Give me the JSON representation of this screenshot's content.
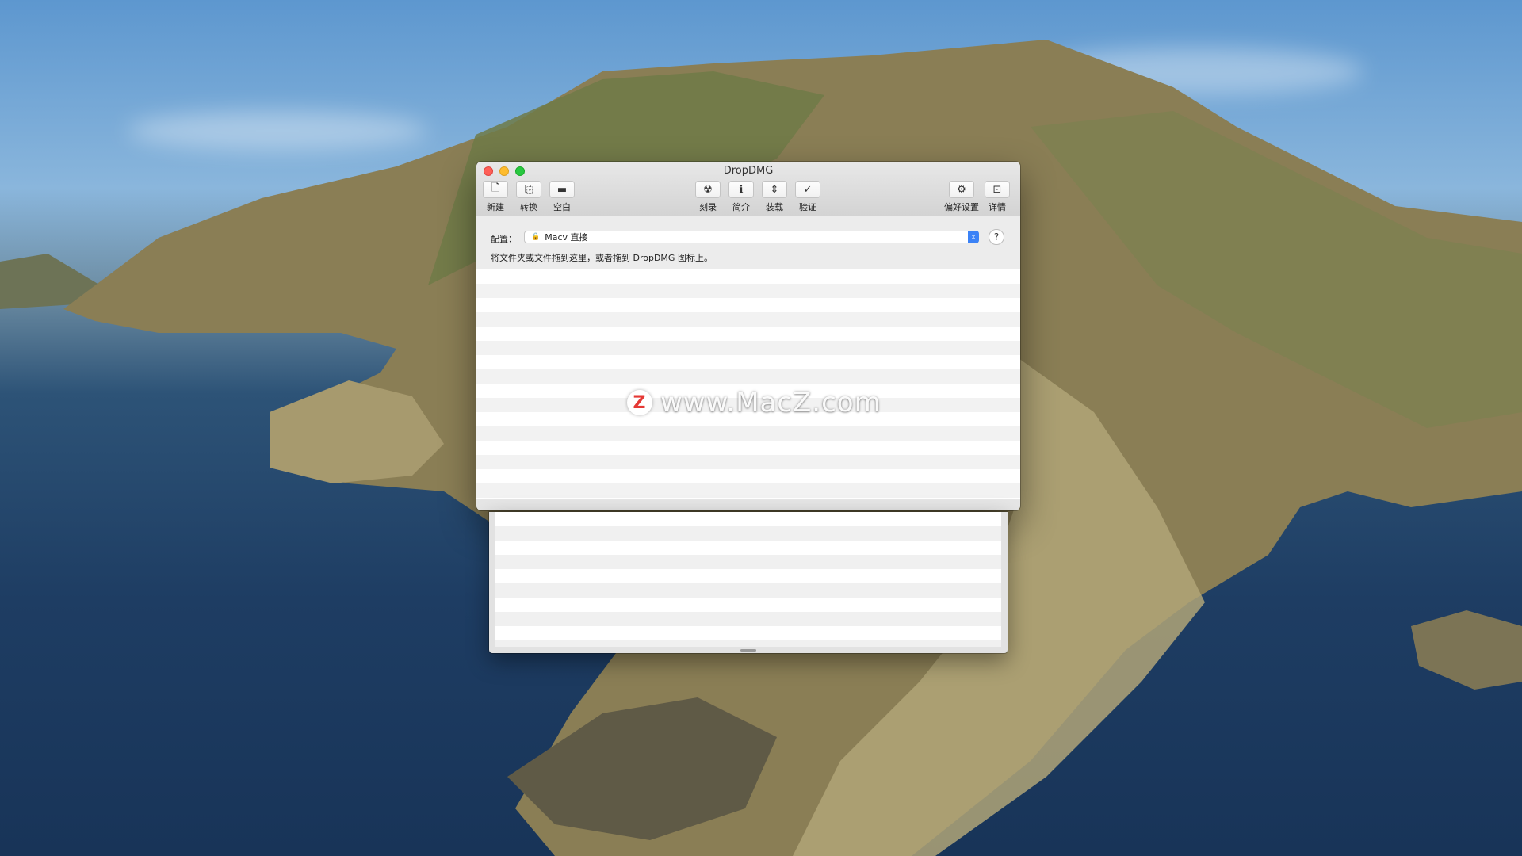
{
  "window": {
    "title": "DropDMG"
  },
  "toolbar": {
    "left": [
      {
        "label": "新建",
        "icon": "new-document-icon",
        "glyph": "🗋"
      },
      {
        "label": "转换",
        "icon": "convert-document-icon",
        "glyph": "⎘"
      },
      {
        "label": "空白",
        "icon": "blank-disk-icon",
        "glyph": "▬"
      }
    ],
    "center": [
      {
        "label": "刻录",
        "icon": "burn-icon",
        "glyph": "☢"
      },
      {
        "label": "简介",
        "icon": "info-icon",
        "glyph": "ℹ"
      },
      {
        "label": "装载",
        "icon": "mount-icon",
        "glyph": "⇕"
      },
      {
        "label": "验证",
        "icon": "checkmark-icon",
        "glyph": "✓"
      }
    ],
    "right": [
      {
        "label": "偏好设置",
        "icon": "gear-icon",
        "glyph": "⚙"
      },
      {
        "label": "详情",
        "icon": "details-icon",
        "glyph": "⊡"
      }
    ]
  },
  "config": {
    "label": "配置：",
    "selected": "Macv 直接",
    "help": "?"
  },
  "hint": "将文件夹或文件拖到这里，或者拖到 DropDMG 图标上。",
  "watermark": {
    "logo": "Z",
    "text": "www.MacZ.com"
  },
  "colors": {
    "accent": "#3b82f6",
    "close": "#fe5f57",
    "minimize": "#febc2e",
    "maximize": "#28c840"
  }
}
